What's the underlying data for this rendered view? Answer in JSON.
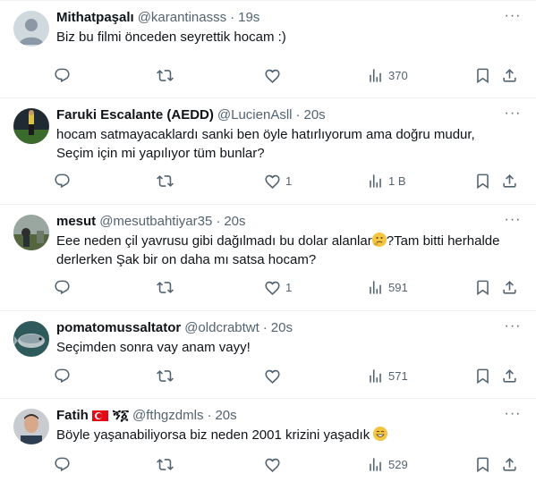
{
  "tweets": [
    {
      "name": "Mithatpaşalı",
      "handle": "@karantinasss",
      "time": "19s",
      "lines": [
        "Biz bu filmi önceden seyrettik hocam :)"
      ],
      "replies": "",
      "retweets": "",
      "likes": "",
      "views": "370"
    },
    {
      "name": "Faruki Escalante (AEDD)",
      "handle": "@LucienAsll",
      "time": "20s",
      "lines": [
        "hocam satmayacaklardı sanki ben öyle hatırlıyorum ama doğru mudur,",
        "Seçim için mi yapılıyor tüm bunlar?"
      ],
      "replies": "",
      "retweets": "",
      "likes": "1",
      "views": "1 B"
    },
    {
      "name": "mesut",
      "handle": "@mesutbahtiyar35",
      "time": "20s",
      "lines": [
        "Eee neden çil yavrusu gibi dağılmadı bu dolar alanlar",
        "?Tam bitti herhalde",
        "derlerken Şak bir on daha mı satsa hocam?"
      ],
      "replies": "",
      "retweets": "",
      "likes": "1",
      "views": "591"
    },
    {
      "name": "pomatomussaltator",
      "handle": "@oldcrabtwt",
      "time": "20s",
      "lines": [
        "Seçimden sonra vay anam vayy!"
      ],
      "replies": "",
      "retweets": "",
      "likes": "",
      "views": "571"
    },
    {
      "name": "Fatih",
      "name_suffix": "ኝ፩",
      "handle": "@fthgzdmls",
      "time": "20s",
      "lines": [
        "Böyle yaşanabiliyorsa biz neden 2001 krizini yaşadık"
      ],
      "replies": "",
      "retweets": "",
      "likes": "",
      "views": "529"
    }
  ],
  "colors": {
    "text": "#0f1419",
    "secondary": "#536471",
    "border": "#eff3f4",
    "flag_red": "#e30a17"
  },
  "icons": [
    "reply-icon",
    "retweet-icon",
    "like-icon",
    "views-icon",
    "bookmark-icon",
    "share-icon",
    "more-icon",
    "thinking-emoji",
    "grin-emoji",
    "turkey-flag"
  ]
}
